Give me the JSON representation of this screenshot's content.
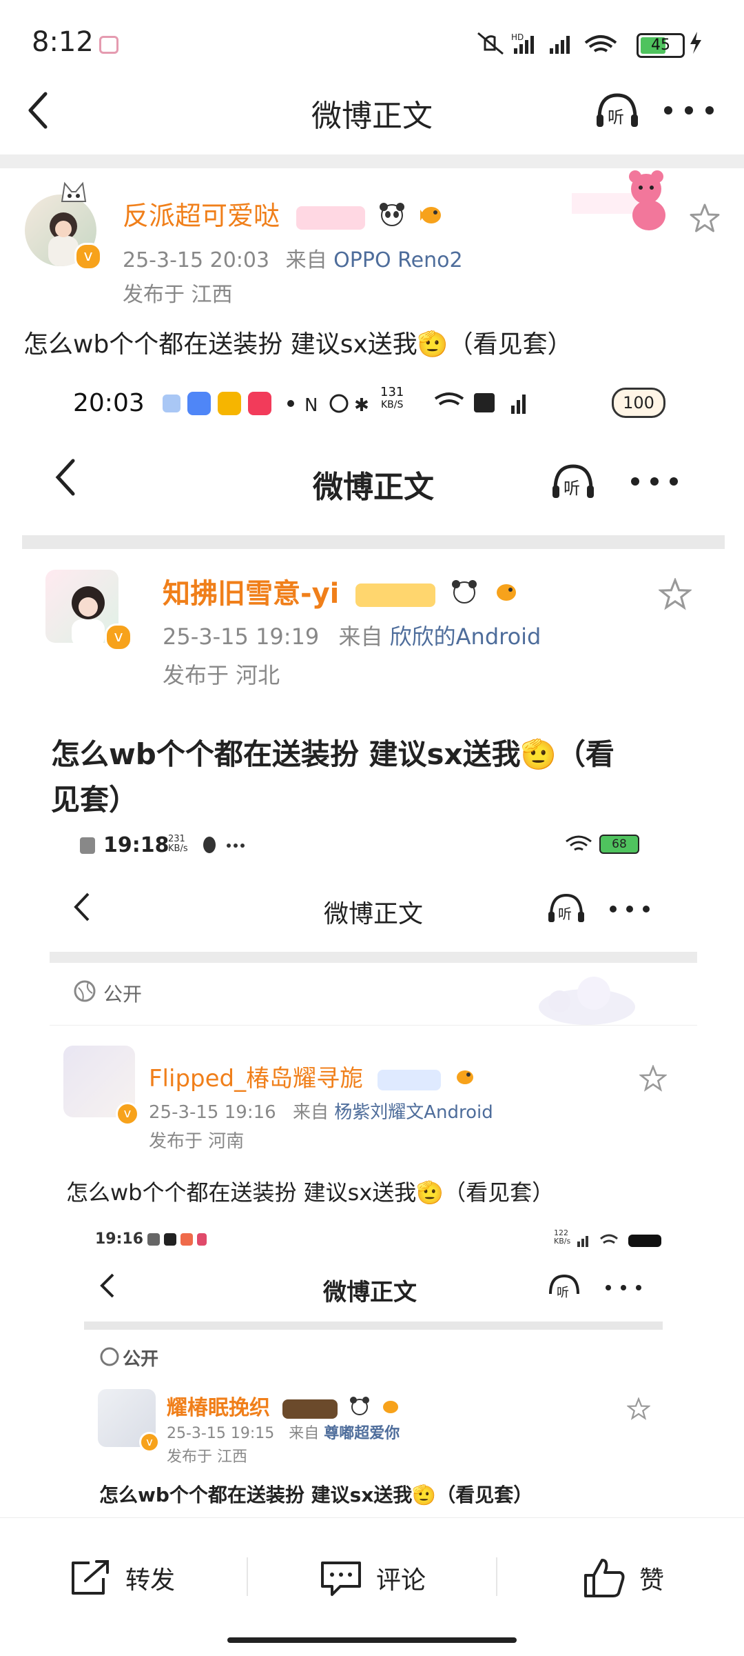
{
  "status_bar": {
    "time": "8:12",
    "battery": "45",
    "network": "HD"
  },
  "header": {
    "title": "微博正文"
  },
  "post": {
    "username": "反派超可爱哒",
    "timestamp": "25-3-15 20:03",
    "from_label": "来自",
    "source": "OPPO Reno2",
    "location": "发布于 江西",
    "text": "怎么wb个个都在送装扮  建议sx送我🫡（看见套）"
  },
  "shot1": {
    "status_time": "20:03",
    "speed": "131",
    "speed_unit": "KB/S",
    "battery": "100",
    "title": "微博正文",
    "username": "知拂旧雪意-yi",
    "timestamp": "25-3-15 19:19",
    "from_label": "来自",
    "source": "欣欣的Android",
    "location": "发布于 河北",
    "text_line1": "怎么wb个个都在送装扮  建议sx送我🫡（看",
    "text_line2": "见套）"
  },
  "shot2": {
    "status_time": "19:18",
    "speed": "231",
    "speed_unit": "KB/s",
    "battery": "68",
    "title": "微博正文",
    "visibility": "公开",
    "username": "Flipped_椿岛耀寻旎",
    "timestamp": "25-3-15 19:16",
    "from_label": "来自",
    "source": "杨紫刘耀文Android",
    "location": "发布于 河南",
    "text": "怎么wb个个都在送装扮  建议sx送我🫡（看见套）"
  },
  "shot3": {
    "status_time": "19:16",
    "speed": "122",
    "speed_unit": "KB/s",
    "title": "微博正文",
    "visibility": "公开",
    "username": "耀椿眠挽织",
    "timestamp": "25-3-15 19:15",
    "from_label": "来自",
    "source": "尊嘟超爱你",
    "location": "发布于 江西",
    "text": "怎么wb个个都在送装扮  建议sx送我🫡（看见套）"
  },
  "actions": {
    "repost": "转发",
    "comment": "评论",
    "like": "赞"
  },
  "colors": {
    "username": "#f07f1a",
    "source_link": "#4e6d9b",
    "muted": "#888888",
    "vip": "#f7a21b"
  }
}
